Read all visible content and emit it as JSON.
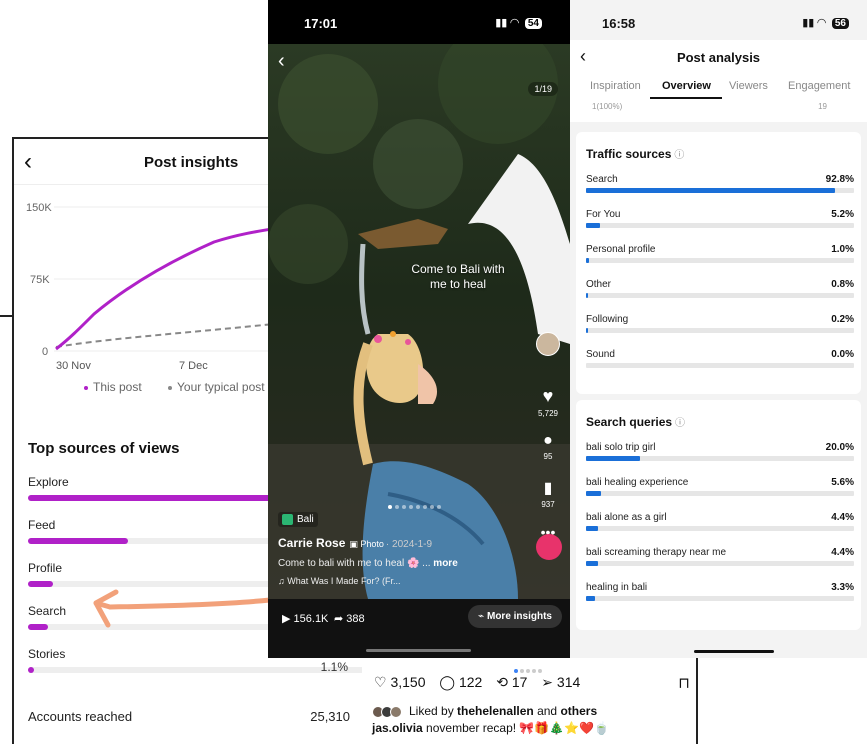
{
  "left_insights": {
    "title": "Post insights",
    "y_ticks": [
      "150K",
      "75K",
      "0"
    ],
    "x_ticks": [
      "30 Nov",
      "7 Dec"
    ],
    "legend": [
      {
        "label": "This post",
        "color": "#b021c8"
      },
      {
        "label": "Your typical post",
        "color": "#888888"
      }
    ],
    "sources_title": "Top sources of views",
    "sources": [
      {
        "label": "Explore",
        "value": 49,
        "pct": ""
      },
      {
        "label": "Feed",
        "value": 20,
        "pct": ""
      },
      {
        "label": "Profile",
        "value": 5,
        "pct": ""
      },
      {
        "label": "Search",
        "value": 4,
        "pct": ""
      },
      {
        "label": "Stories",
        "value": 1.1,
        "pct": "1.1%"
      }
    ],
    "accounts_reached_label": "Accounts reached",
    "accounts_reached_value": "25,310",
    "accent_color": "#b021c8",
    "arrow_color": "#f2a17a"
  },
  "tiktok_post": {
    "time": "17:01",
    "battery": "54",
    "counter": "1/19",
    "caption": "Come to Bali with me to heal",
    "likes": "5,729",
    "comments": "95",
    "saves": "937",
    "location": "Bali",
    "author": "Carrie Rose",
    "post_type": "Photo",
    "date": "· 2024-1-9",
    "description": "Come to bali with me to heal 🌸 ...",
    "more": "more",
    "music": "♫ What Was I Made For? (Fr...",
    "plays": "156.1K",
    "shares": "388",
    "more_insights": "More insights"
  },
  "post_analysis": {
    "time": "16:58",
    "battery": "56",
    "title": "Post analysis",
    "tabs": [
      "Inspiration",
      "Overview",
      "Viewers",
      "Engagement"
    ],
    "active_tab": "Overview",
    "prev_row_left": "1(100%)",
    "prev_row_right": "19",
    "traffic_title": "Traffic sources",
    "traffic": [
      {
        "label": "Search",
        "value": 92.8,
        "pct": "92.8%"
      },
      {
        "label": "For You",
        "value": 5.2,
        "pct": "5.2%"
      },
      {
        "label": "Personal profile",
        "value": 1.0,
        "pct": "1.0%"
      },
      {
        "label": "Other",
        "value": 0.8,
        "pct": "0.8%"
      },
      {
        "label": "Following",
        "value": 0.2,
        "pct": "0.2%"
      },
      {
        "label": "Sound",
        "value": 0.0,
        "pct": "0.0%"
      }
    ],
    "queries_title": "Search queries",
    "queries": [
      {
        "label": "bali solo trip girl",
        "value": 20.0,
        "pct": "20.0%"
      },
      {
        "label": "bali healing experience",
        "value": 5.6,
        "pct": "5.6%"
      },
      {
        "label": "bali alone as a girl",
        "value": 4.4,
        "pct": "4.4%"
      },
      {
        "label": "bali screaming therapy near me",
        "value": 4.4,
        "pct": "4.4%"
      },
      {
        "label": "healing in bali",
        "value": 3.3,
        "pct": "3.3%"
      }
    ],
    "bar_color": "#1a6fd8"
  },
  "ig_footer": {
    "likes": "3,150",
    "comments": "122",
    "reposts": "17",
    "shares": "314",
    "liked_prefix": "Liked by",
    "liked_user": "thehelenallen",
    "liked_and": "and",
    "liked_others": "others",
    "caption_user": "jas.olivia",
    "caption_text": "november recap! 🎀🎁🎄⭐❤️🍵"
  }
}
